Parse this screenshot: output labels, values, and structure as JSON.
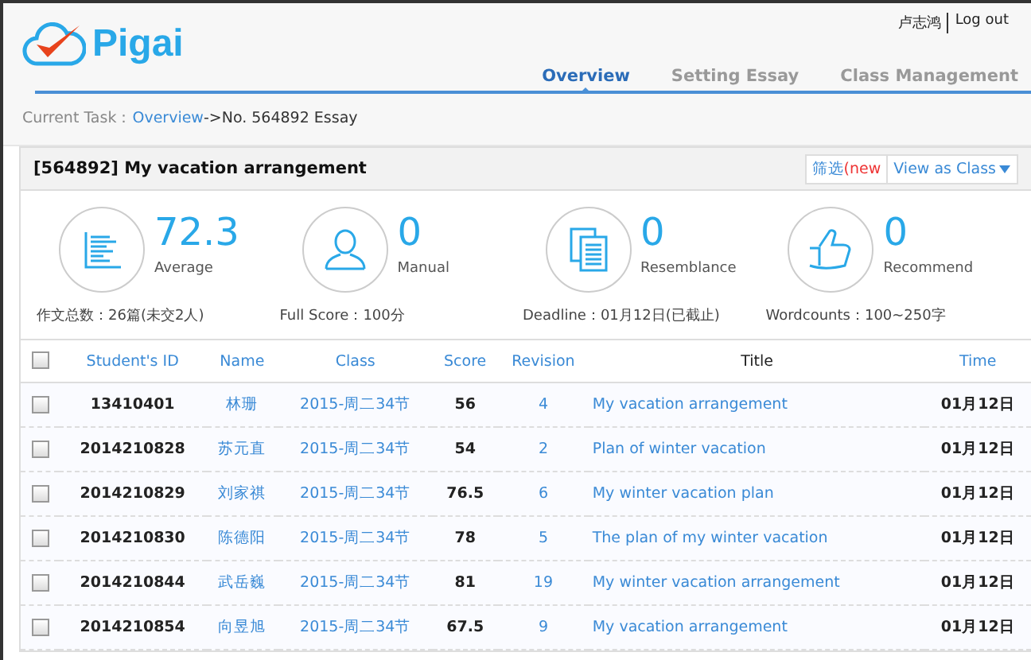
{
  "header": {
    "logo": "Pigai",
    "user": "卢志鸿",
    "logout": "Log out",
    "tabs": [
      {
        "label": "Overview",
        "selected": true
      },
      {
        "label": "Setting Essay",
        "selected": false
      },
      {
        "label": "Class Management",
        "selected": false
      }
    ]
  },
  "breadcrumb": {
    "prefix": "Current Task：",
    "link": "Overview",
    "rest": "->No. 564892 Essay"
  },
  "panel": {
    "title": "[564892] My vacation arrangement",
    "filter_label": "筛选",
    "filter_badge": "(new",
    "view_button": "View as Class",
    "stats": [
      {
        "kind": "average",
        "value": "72.3",
        "label": "Average",
        "note": "作文总数：26篇(未交2人)"
      },
      {
        "kind": "manual",
        "value": "0",
        "label": "Manual",
        "note": "Full Score：100分"
      },
      {
        "kind": "resemblance",
        "value": "0",
        "label": "Resemblance",
        "note": "Deadline：01月12日(已截止)"
      },
      {
        "kind": "recommend",
        "value": "0",
        "label": "Recommend",
        "note": "Wordcounts：100~250字"
      }
    ]
  },
  "table": {
    "select_all": {
      "checked": false
    },
    "columns": [
      "Student's ID",
      "Name",
      "Class",
      "Score",
      "Revision",
      "Title",
      "Time"
    ],
    "rows": [
      {
        "checked": false,
        "id": "13410401",
        "name": "林珊",
        "class": "2015-周二34节",
        "score": "56",
        "revision": "4",
        "title": "My vacation arrangement",
        "time": "01月12日"
      },
      {
        "checked": false,
        "id": "2014210828",
        "name": "苏元直",
        "class": "2015-周二34节",
        "score": "54",
        "revision": "2",
        "title": "Plan of winter vacation",
        "time": "01月12日"
      },
      {
        "checked": false,
        "id": "2014210829",
        "name": "刘家祺",
        "class": "2015-周二34节",
        "score": "76.5",
        "revision": "6",
        "title": "My winter vacation plan",
        "time": "01月12日"
      },
      {
        "checked": false,
        "id": "2014210830",
        "name": "陈德阳",
        "class": "2015-周二34节",
        "score": "78",
        "revision": "5",
        "title": "The plan of my winter vacation",
        "time": "01月12日"
      },
      {
        "checked": false,
        "id": "2014210844",
        "name": "武岳巍",
        "class": "2015-周二34节",
        "score": "81",
        "revision": "19",
        "title": "My winter vacation arrangement",
        "time": "01月12日"
      },
      {
        "checked": false,
        "id": "2014210854",
        "name": "向昱旭",
        "class": "2015-周二34节",
        "score": "67.5",
        "revision": "9",
        "title": "My vacation arrangement",
        "time": "01月12日"
      }
    ]
  }
}
